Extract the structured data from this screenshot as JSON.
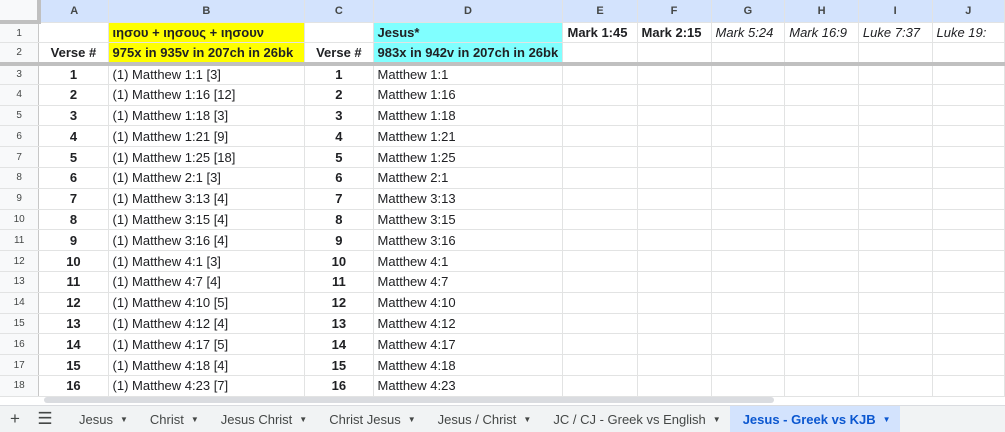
{
  "columns": [
    "A",
    "B",
    "C",
    "D",
    "E",
    "F",
    "G",
    "H",
    "I",
    "J"
  ],
  "row1": {
    "number": "1",
    "a": "",
    "b": "ιησου + ιησους + ιησουν",
    "c": "",
    "d": "Jesus*",
    "e": "Mark 1:45",
    "f": "Mark 2:15",
    "g": "Mark 5:24",
    "h": "Mark 16:9",
    "i": "Luke 7:37",
    "j": "Luke 19:"
  },
  "row2": {
    "number": "2",
    "a": "Verse #",
    "b": "975x in 935v in 207ch in 26bk",
    "c": "Verse #",
    "d": "983x in 942v in 207ch in 26bk"
  },
  "rows": [
    {
      "number": "3",
      "verse": "1",
      "greek": "(1) Matthew 1:1 [3]",
      "verse2": "1",
      "kjb": "Matthew 1:1"
    },
    {
      "number": "4",
      "verse": "2",
      "greek": "(1) Matthew 1:16 [12]",
      "verse2": "2",
      "kjb": "Matthew 1:16"
    },
    {
      "number": "5",
      "verse": "3",
      "greek": "(1) Matthew 1:18 [3]",
      "verse2": "3",
      "kjb": "Matthew 1:18"
    },
    {
      "number": "6",
      "verse": "4",
      "greek": "(1) Matthew 1:21 [9]",
      "verse2": "4",
      "kjb": "Matthew 1:21"
    },
    {
      "number": "7",
      "verse": "5",
      "greek": "(1) Matthew 1:25 [18]",
      "verse2": "5",
      "kjb": "Matthew 1:25"
    },
    {
      "number": "8",
      "verse": "6",
      "greek": "(1) Matthew 2:1 [3]",
      "verse2": "6",
      "kjb": "Matthew 2:1"
    },
    {
      "number": "9",
      "verse": "7",
      "greek": "(1) Matthew 3:13 [4]",
      "verse2": "7",
      "kjb": "Matthew 3:13"
    },
    {
      "number": "10",
      "verse": "8",
      "greek": "(1) Matthew 3:15 [4]",
      "verse2": "8",
      "kjb": "Matthew 3:15"
    },
    {
      "number": "11",
      "verse": "9",
      "greek": "(1) Matthew 3:16 [4]",
      "verse2": "9",
      "kjb": "Matthew 3:16"
    },
    {
      "number": "12",
      "verse": "10",
      "greek": "(1) Matthew 4:1 [3]",
      "verse2": "10",
      "kjb": "Matthew 4:1"
    },
    {
      "number": "13",
      "verse": "11",
      "greek": "(1) Matthew 4:7 [4]",
      "verse2": "11",
      "kjb": "Matthew 4:7"
    },
    {
      "number": "14",
      "verse": "12",
      "greek": "(1) Matthew 4:10 [5]",
      "verse2": "12",
      "kjb": "Matthew 4:10"
    },
    {
      "number": "15",
      "verse": "13",
      "greek": "(1) Matthew 4:12 [4]",
      "verse2": "13",
      "kjb": "Matthew 4:12"
    },
    {
      "number": "16",
      "verse": "14",
      "greek": "(1) Matthew 4:17 [5]",
      "verse2": "14",
      "kjb": "Matthew 4:17"
    },
    {
      "number": "17",
      "verse": "15",
      "greek": "(1) Matthew 4:18 [4]",
      "verse2": "15",
      "kjb": "Matthew 4:18"
    },
    {
      "number": "18",
      "verse": "16",
      "greek": "(1) Matthew 4:23 [7]",
      "verse2": "16",
      "kjb": "Matthew 4:23"
    }
  ],
  "tabbar": {
    "add_icon": "plus-icon",
    "menu_icon": "hamburger-menu-icon",
    "tabs": [
      "Jesus",
      "Christ",
      "Jesus Christ",
      "Christ Jesus",
      "Jesus / Christ",
      "JC / CJ - Greek vs English",
      "Jesus - Greek vs KJB"
    ],
    "active_tab": "Jesus - Greek vs KJB"
  },
  "colors": {
    "header_yellow": "#ffff00",
    "header_cyan": "#80ffff",
    "column_header_bg": "#d3e3fd",
    "active_tab_text": "#0b57d0"
  }
}
